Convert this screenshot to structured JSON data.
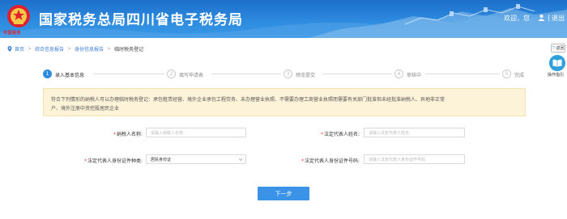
{
  "header": {
    "logo_text": "中国税务",
    "title": "国家税务总局四川省电子税务局",
    "welcome": "欢迎，您",
    "separator": "|",
    "logout": "退出",
    "bg_color": "#2a85dc"
  },
  "breadcrumb": {
    "items": [
      "首页",
      "综合信息报告",
      "身份信息报告",
      "临时税务登记"
    ],
    "separator": ">"
  },
  "side": {
    "back_label": "返回",
    "guide_label": "操作指引"
  },
  "steps": [
    {
      "num": "1",
      "label": "录入基本信息",
      "active": true
    },
    {
      "num": "2",
      "label": "填写申请表",
      "active": false
    },
    {
      "num": "3",
      "label": "预览提交",
      "active": false
    },
    {
      "num": "4",
      "label": "审核中",
      "active": false
    },
    {
      "num": "5",
      "label": "完成",
      "active": false
    }
  ],
  "notice": {
    "line1": "符合下列情形的纳税人可以办理临时税务登记：承包租赁经营、境外企业承包工程劳务、未办理营业执照、不需要办理工商营业执照而需要有关部门批准但未经批准纳税人、异地非正常",
    "line2": "户、境外注册中资控股居民企业"
  },
  "form": {
    "taxpayer_name": {
      "label": "纳税人名称:",
      "placeholder": "请输入纳税人名称"
    },
    "legal_rep_name": {
      "label": "法定代表人姓名:",
      "placeholder": "请输入法定代表人姓名"
    },
    "id_type": {
      "label": "法定代表人身份证件种类:",
      "value": "居民身份证"
    },
    "id_number": {
      "label": "法定代表人身份证件号码:",
      "placeholder": "请输入法定代表人身份证件号码"
    },
    "required_mark": "*"
  },
  "next_button": "下一步",
  "colors": {
    "accent": "#3b93e7",
    "notice_bg": "#fdf3d8",
    "required": "#e33333"
  }
}
